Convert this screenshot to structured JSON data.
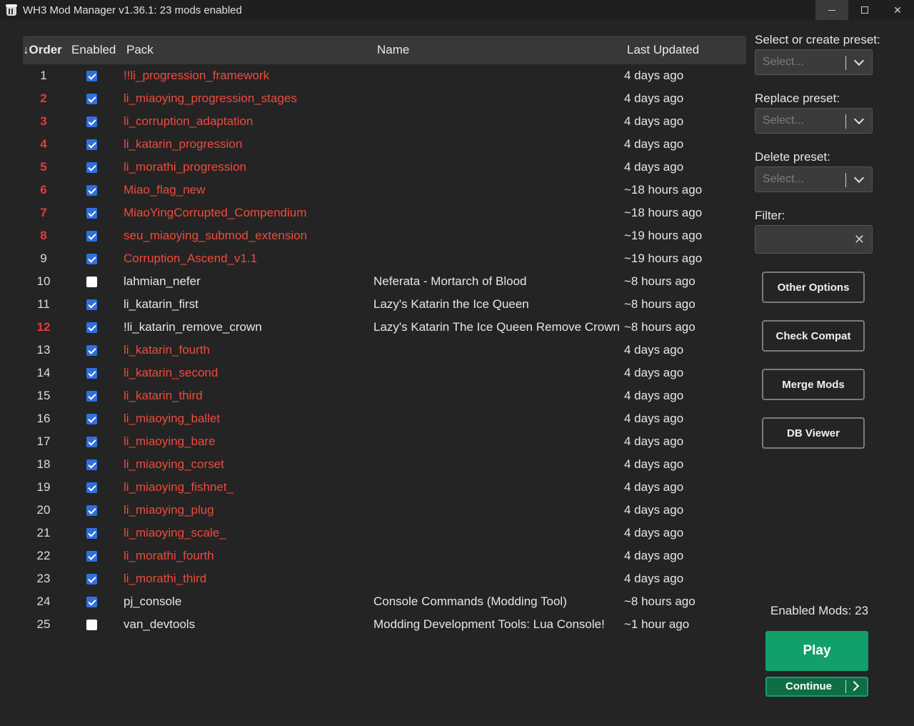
{
  "window": {
    "title": "WH3 Mod Manager v1.36.1: 23 mods enabled"
  },
  "table": {
    "headers": {
      "order": "↓Order",
      "enabled": "Enabled",
      "pack": "Pack",
      "name": "Name",
      "updated": "Last Updated"
    },
    "rows": [
      {
        "order": "1",
        "order_red": false,
        "enabled": true,
        "pack": "!!li_progression_framework",
        "pack_red": true,
        "name": "",
        "updated": "4 days ago"
      },
      {
        "order": "2",
        "order_red": true,
        "enabled": true,
        "pack": "li_miaoying_progression_stages",
        "pack_red": true,
        "name": "",
        "updated": "4 days ago"
      },
      {
        "order": "3",
        "order_red": true,
        "enabled": true,
        "pack": "li_corruption_adaptation",
        "pack_red": true,
        "name": "",
        "updated": "4 days ago"
      },
      {
        "order": "4",
        "order_red": true,
        "enabled": true,
        "pack": "li_katarin_progression",
        "pack_red": true,
        "name": "",
        "updated": "4 days ago"
      },
      {
        "order": "5",
        "order_red": true,
        "enabled": true,
        "pack": "li_morathi_progression",
        "pack_red": true,
        "name": "",
        "updated": "4 days ago"
      },
      {
        "order": "6",
        "order_red": true,
        "enabled": true,
        "pack": "Miao_flag_new",
        "pack_red": true,
        "name": "",
        "updated": "~18 hours ago"
      },
      {
        "order": "7",
        "order_red": true,
        "enabled": true,
        "pack": "MiaoYingCorrupted_Compendium",
        "pack_red": true,
        "name": "",
        "updated": "~18 hours ago"
      },
      {
        "order": "8",
        "order_red": true,
        "enabled": true,
        "pack": "seu_miaoying_submod_extension",
        "pack_red": true,
        "name": "",
        "updated": "~19 hours ago"
      },
      {
        "order": "9",
        "order_red": false,
        "enabled": true,
        "pack": "Corruption_Ascend_v1.1",
        "pack_red": true,
        "name": "",
        "updated": "~19 hours ago"
      },
      {
        "order": "10",
        "order_red": false,
        "enabled": false,
        "pack": "lahmian_nefer",
        "pack_red": false,
        "name": "Neferata - Mortarch of Blood",
        "updated": "~8 hours ago"
      },
      {
        "order": "11",
        "order_red": false,
        "enabled": true,
        "pack": "li_katarin_first",
        "pack_red": false,
        "name": "Lazy's Katarin the Ice Queen",
        "updated": "~8 hours ago"
      },
      {
        "order": "12",
        "order_red": true,
        "enabled": true,
        "pack": "!li_katarin_remove_crown",
        "pack_red": false,
        "name": "Lazy's Katarin The Ice Queen Remove Crown",
        "updated": "~8 hours ago"
      },
      {
        "order": "13",
        "order_red": false,
        "enabled": true,
        "pack": "li_katarin_fourth",
        "pack_red": true,
        "name": "",
        "updated": "4 days ago"
      },
      {
        "order": "14",
        "order_red": false,
        "enabled": true,
        "pack": "li_katarin_second",
        "pack_red": true,
        "name": "",
        "updated": "4 days ago"
      },
      {
        "order": "15",
        "order_red": false,
        "enabled": true,
        "pack": "li_katarin_third",
        "pack_red": true,
        "name": "",
        "updated": "4 days ago"
      },
      {
        "order": "16",
        "order_red": false,
        "enabled": true,
        "pack": "li_miaoying_ballet",
        "pack_red": true,
        "name": "",
        "updated": "4 days ago"
      },
      {
        "order": "17",
        "order_red": false,
        "enabled": true,
        "pack": "li_miaoying_bare",
        "pack_red": true,
        "name": "",
        "updated": "4 days ago"
      },
      {
        "order": "18",
        "order_red": false,
        "enabled": true,
        "pack": "li_miaoying_corset",
        "pack_red": true,
        "name": "",
        "updated": "4 days ago"
      },
      {
        "order": "19",
        "order_red": false,
        "enabled": true,
        "pack": "li_miaoying_fishnet_",
        "pack_red": true,
        "name": "",
        "updated": "4 days ago"
      },
      {
        "order": "20",
        "order_red": false,
        "enabled": true,
        "pack": "li_miaoying_plug",
        "pack_red": true,
        "name": "",
        "updated": "4 days ago"
      },
      {
        "order": "21",
        "order_red": false,
        "enabled": true,
        "pack": "li_miaoying_scale_",
        "pack_red": true,
        "name": "",
        "updated": "4 days ago"
      },
      {
        "order": "22",
        "order_red": false,
        "enabled": true,
        "pack": "li_morathi_fourth",
        "pack_red": true,
        "name": "",
        "updated": "4 days ago"
      },
      {
        "order": "23",
        "order_red": false,
        "enabled": true,
        "pack": "li_morathi_third",
        "pack_red": true,
        "name": "",
        "updated": "4 days ago"
      },
      {
        "order": "24",
        "order_red": false,
        "enabled": true,
        "pack": "pj_console",
        "pack_red": false,
        "name": "Console Commands (Modding Tool)",
        "updated": "~8 hours ago"
      },
      {
        "order": "25",
        "order_red": false,
        "enabled": false,
        "pack": "van_devtools",
        "pack_red": false,
        "name": "Modding Development Tools: Lua Console!",
        "updated": "~1 hour ago"
      }
    ]
  },
  "sidebar": {
    "select_preset_label": "Select or create preset:",
    "replace_preset_label": "Replace preset:",
    "delete_preset_label": "Delete preset:",
    "select_placeholder": "Select...",
    "filter_label": "Filter:",
    "filter_value": "",
    "other_options": "Other Options",
    "check_compat": "Check Compat",
    "merge_mods": "Merge Mods",
    "db_viewer": "DB Viewer",
    "enabled_mods": "Enabled Mods: 23",
    "play": "Play",
    "continue": "Continue"
  },
  "colors": {
    "accent_green": "#12a06a",
    "error_red": "#ef4a3c",
    "checkbox_blue": "#2f6fe0"
  }
}
